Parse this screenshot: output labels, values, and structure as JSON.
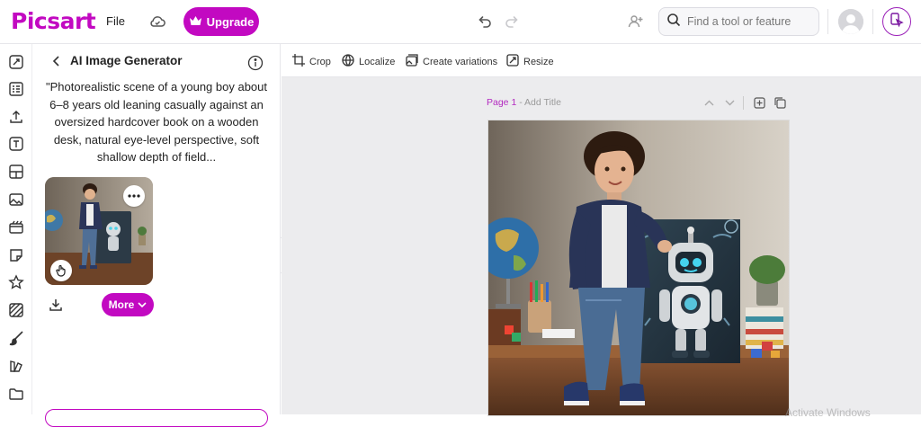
{
  "header": {
    "logo": "Picsart",
    "file_label": "File",
    "upgrade_label": "Upgrade",
    "search_placeholder": "Find a tool or feature"
  },
  "panel": {
    "title": "AI Image Generator",
    "prompt": "\"Photorealistic scene of a young boy about 6–8 years old leaning casually against an oversized hardcover book on a wooden desk, natural eye-level perspective, soft shallow depth of field...",
    "more_label": "More"
  },
  "toolbar": {
    "crop": "Crop",
    "localize": "Localize",
    "create_variations": "Create variations",
    "resize": "Resize"
  },
  "canvas": {
    "page_number": "Page 1",
    "page_separator": " - ",
    "page_title_placeholder": "Add Title",
    "watermark": "Activate Windows"
  },
  "colors": {
    "brand": "#c209c1",
    "canvas_bg": "#ececee"
  },
  "icons": [
    "cloud-icon",
    "crown-icon",
    "undo-icon",
    "redo-icon",
    "add-user-icon",
    "search-icon",
    "avatar-icon",
    "mobile-app-icon",
    "back-arrow-icon",
    "info-icon",
    "more-dots-icon",
    "hand-pointer-icon",
    "download-icon",
    "chevron-down-icon",
    "crop-icon",
    "localize-icon",
    "variations-icon",
    "resize-icon",
    "chevron-up-icon",
    "add-page-icon",
    "duplicate-page-icon"
  ]
}
